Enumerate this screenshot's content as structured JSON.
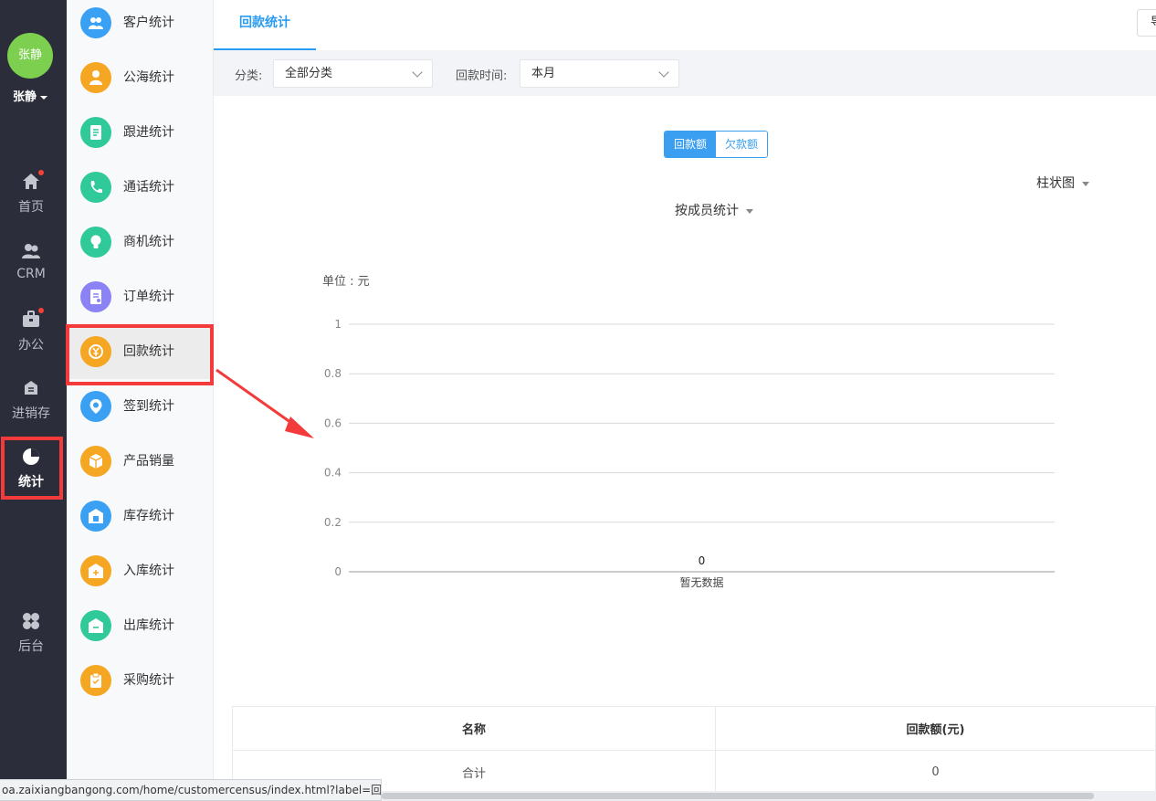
{
  "user": {
    "avatar_text": "张静",
    "name": "张静"
  },
  "rail": {
    "items": [
      {
        "label": "首页",
        "icon": "home-icon",
        "badge": true
      },
      {
        "label": "CRM",
        "icon": "crm-users-icon",
        "badge": false
      },
      {
        "label": "办公",
        "icon": "briefcase-icon",
        "badge": true
      },
      {
        "label": "进销存",
        "icon": "inventory-icon",
        "badge": false
      },
      {
        "label": "统计",
        "icon": "pie-chart-icon",
        "badge": false,
        "active": true
      },
      {
        "label": "后台",
        "icon": "clover-grid-icon",
        "badge": false
      }
    ]
  },
  "subnav": {
    "items": [
      {
        "label": "客户统计",
        "icon": "customers-icon",
        "color": "#3aa0f3"
      },
      {
        "label": "公海统计",
        "icon": "person-icon",
        "color": "#f5a623"
      },
      {
        "label": "跟进统计",
        "icon": "document-icon",
        "color": "#2fc99a"
      },
      {
        "label": "通话统计",
        "icon": "phone-icon",
        "color": "#2fc99a"
      },
      {
        "label": "商机统计",
        "icon": "lightbulb-icon",
        "color": "#2fc99a"
      },
      {
        "label": "订单统计",
        "icon": "order-icon",
        "color": "#8a82f5"
      },
      {
        "label": "回款统计",
        "icon": "money-cycle-icon",
        "color": "#f5a623",
        "active": true
      },
      {
        "label": "签到统计",
        "icon": "location-pin-icon",
        "color": "#3aa0f3"
      },
      {
        "label": "产品销量",
        "icon": "box-icon",
        "color": "#f5a623"
      },
      {
        "label": "库存统计",
        "icon": "warehouse-icon",
        "color": "#3aa0f3"
      },
      {
        "label": "入库统计",
        "icon": "stock-in-icon",
        "color": "#f5a623"
      },
      {
        "label": "出库统计",
        "icon": "stock-out-icon",
        "color": "#2fc99a"
      },
      {
        "label": "采购统计",
        "icon": "purchase-icon",
        "color": "#f5a623"
      }
    ]
  },
  "main": {
    "tab": "回款统计",
    "export_label": "导",
    "filters": {
      "category_label": "分类:",
      "category_value": "全部分类",
      "time_label": "回款时间:",
      "time_value": "本月"
    },
    "toggle": {
      "option1": "回款额",
      "option2": "欠款额"
    },
    "chart_type_select": "柱状图",
    "group_select": "按成员统计"
  },
  "chart_data": {
    "type": "bar",
    "unit_label": "单位 : 元",
    "categories": [
      "暂无数据"
    ],
    "values": [
      0
    ],
    "value_labels": [
      "0"
    ],
    "yticks": [
      "1",
      "0.8",
      "0.6",
      "0.4",
      "0.2",
      "0"
    ],
    "ylim": [
      0,
      1
    ],
    "grid": true
  },
  "table": {
    "headers": [
      "名称",
      "回款额(元)"
    ],
    "rows": [
      [
        "合计",
        "0"
      ]
    ]
  },
  "statusbar": {
    "url": "oa.zaixiangbangong.com/home/customercensus/index.html?label=回..."
  },
  "colors": {
    "accent": "#2a9bf0",
    "highlight": "#f23b3a",
    "rail_bg": "#2b2e3a"
  }
}
